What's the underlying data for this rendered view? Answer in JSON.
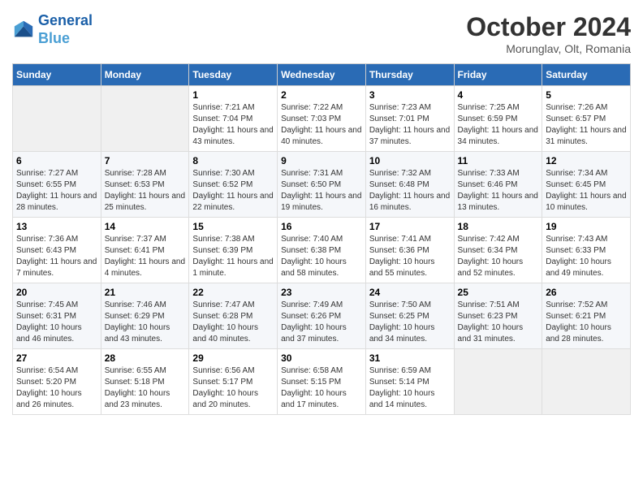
{
  "header": {
    "logo_line1": "General",
    "logo_line2": "Blue",
    "month": "October 2024",
    "location": "Morunglav, Olt, Romania"
  },
  "weekdays": [
    "Sunday",
    "Monday",
    "Tuesday",
    "Wednesday",
    "Thursday",
    "Friday",
    "Saturday"
  ],
  "weeks": [
    [
      {
        "day": "",
        "info": ""
      },
      {
        "day": "",
        "info": ""
      },
      {
        "day": "1",
        "info": "Sunrise: 7:21 AM\nSunset: 7:04 PM\nDaylight: 11 hours and 43 minutes."
      },
      {
        "day": "2",
        "info": "Sunrise: 7:22 AM\nSunset: 7:03 PM\nDaylight: 11 hours and 40 minutes."
      },
      {
        "day": "3",
        "info": "Sunrise: 7:23 AM\nSunset: 7:01 PM\nDaylight: 11 hours and 37 minutes."
      },
      {
        "day": "4",
        "info": "Sunrise: 7:25 AM\nSunset: 6:59 PM\nDaylight: 11 hours and 34 minutes."
      },
      {
        "day": "5",
        "info": "Sunrise: 7:26 AM\nSunset: 6:57 PM\nDaylight: 11 hours and 31 minutes."
      }
    ],
    [
      {
        "day": "6",
        "info": "Sunrise: 7:27 AM\nSunset: 6:55 PM\nDaylight: 11 hours and 28 minutes."
      },
      {
        "day": "7",
        "info": "Sunrise: 7:28 AM\nSunset: 6:53 PM\nDaylight: 11 hours and 25 minutes."
      },
      {
        "day": "8",
        "info": "Sunrise: 7:30 AM\nSunset: 6:52 PM\nDaylight: 11 hours and 22 minutes."
      },
      {
        "day": "9",
        "info": "Sunrise: 7:31 AM\nSunset: 6:50 PM\nDaylight: 11 hours and 19 minutes."
      },
      {
        "day": "10",
        "info": "Sunrise: 7:32 AM\nSunset: 6:48 PM\nDaylight: 11 hours and 16 minutes."
      },
      {
        "day": "11",
        "info": "Sunrise: 7:33 AM\nSunset: 6:46 PM\nDaylight: 11 hours and 13 minutes."
      },
      {
        "day": "12",
        "info": "Sunrise: 7:34 AM\nSunset: 6:45 PM\nDaylight: 11 hours and 10 minutes."
      }
    ],
    [
      {
        "day": "13",
        "info": "Sunrise: 7:36 AM\nSunset: 6:43 PM\nDaylight: 11 hours and 7 minutes."
      },
      {
        "day": "14",
        "info": "Sunrise: 7:37 AM\nSunset: 6:41 PM\nDaylight: 11 hours and 4 minutes."
      },
      {
        "day": "15",
        "info": "Sunrise: 7:38 AM\nSunset: 6:39 PM\nDaylight: 11 hours and 1 minute."
      },
      {
        "day": "16",
        "info": "Sunrise: 7:40 AM\nSunset: 6:38 PM\nDaylight: 10 hours and 58 minutes."
      },
      {
        "day": "17",
        "info": "Sunrise: 7:41 AM\nSunset: 6:36 PM\nDaylight: 10 hours and 55 minutes."
      },
      {
        "day": "18",
        "info": "Sunrise: 7:42 AM\nSunset: 6:34 PM\nDaylight: 10 hours and 52 minutes."
      },
      {
        "day": "19",
        "info": "Sunrise: 7:43 AM\nSunset: 6:33 PM\nDaylight: 10 hours and 49 minutes."
      }
    ],
    [
      {
        "day": "20",
        "info": "Sunrise: 7:45 AM\nSunset: 6:31 PM\nDaylight: 10 hours and 46 minutes."
      },
      {
        "day": "21",
        "info": "Sunrise: 7:46 AM\nSunset: 6:29 PM\nDaylight: 10 hours and 43 minutes."
      },
      {
        "day": "22",
        "info": "Sunrise: 7:47 AM\nSunset: 6:28 PM\nDaylight: 10 hours and 40 minutes."
      },
      {
        "day": "23",
        "info": "Sunrise: 7:49 AM\nSunset: 6:26 PM\nDaylight: 10 hours and 37 minutes."
      },
      {
        "day": "24",
        "info": "Sunrise: 7:50 AM\nSunset: 6:25 PM\nDaylight: 10 hours and 34 minutes."
      },
      {
        "day": "25",
        "info": "Sunrise: 7:51 AM\nSunset: 6:23 PM\nDaylight: 10 hours and 31 minutes."
      },
      {
        "day": "26",
        "info": "Sunrise: 7:52 AM\nSunset: 6:21 PM\nDaylight: 10 hours and 28 minutes."
      }
    ],
    [
      {
        "day": "27",
        "info": "Sunrise: 6:54 AM\nSunset: 5:20 PM\nDaylight: 10 hours and 26 minutes."
      },
      {
        "day": "28",
        "info": "Sunrise: 6:55 AM\nSunset: 5:18 PM\nDaylight: 10 hours and 23 minutes."
      },
      {
        "day": "29",
        "info": "Sunrise: 6:56 AM\nSunset: 5:17 PM\nDaylight: 10 hours and 20 minutes."
      },
      {
        "day": "30",
        "info": "Sunrise: 6:58 AM\nSunset: 5:15 PM\nDaylight: 10 hours and 17 minutes."
      },
      {
        "day": "31",
        "info": "Sunrise: 6:59 AM\nSunset: 5:14 PM\nDaylight: 10 hours and 14 minutes."
      },
      {
        "day": "",
        "info": ""
      },
      {
        "day": "",
        "info": ""
      }
    ]
  ]
}
